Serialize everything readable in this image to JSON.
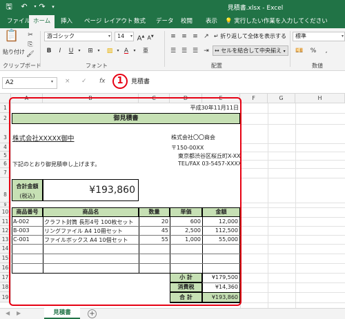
{
  "window": {
    "title": "見積書.xlsx - Excel",
    "accent": "#217346",
    "save_icon": "save-icon",
    "undo_icon": "undo-icon",
    "redo_icon": "redo-icon",
    "customize_icon": "customize-icon"
  },
  "tabs": [
    "ファイル",
    "ホーム",
    "挿入",
    "ページ レイアウト",
    "数式",
    "データ",
    "校閲",
    "表示"
  ],
  "tell_me": "実行したい作業を入力してください",
  "ribbon": {
    "paste": "貼り付け",
    "clipboard": "クリップボード",
    "font_name": "游ゴシック",
    "font_size": "14",
    "font_group": "フォント",
    "bold": "B",
    "italic": "I",
    "underline": "U",
    "font_color": "A",
    "wrap_text": "折り返して全体を表示する",
    "merge_center": "セルを結合して中央揃え",
    "alignment_group": "配置",
    "number_format": "標準",
    "number_group": "数値",
    "percent": "%"
  },
  "formula_bar": {
    "name_box": "A2",
    "cancel": "×",
    "enter": "✓",
    "fx": "fx",
    "content": "見積書",
    "callout_number": "1"
  },
  "columns": [
    "A",
    "B",
    "C",
    "D",
    "E",
    "F",
    "G",
    "H"
  ],
  "rows": [
    "1",
    "2",
    "3",
    "4",
    "5",
    "6",
    "7",
    "8",
    "9",
    "10",
    "11",
    "12",
    "13",
    "14",
    "15",
    "16",
    "17",
    "18",
    "19"
  ],
  "sheet": {
    "date": "平成30年11月11日",
    "title": "御見積書",
    "customer": "株式会社XXXXX御中",
    "company": "株式会社〇〇商会",
    "postal": "〒150-00XX",
    "address": "東京都渋谷区桜丘町X-XX",
    "tel": "TEL/FAX 03-5457-XXXX",
    "greeting": "下記のとおり御見積申し上げます。",
    "total_label": "合計金額",
    "total_tax": "(税込)",
    "total_value": "¥193,860",
    "table_headers": [
      "商品番号",
      "商品名",
      "数量",
      "単価",
      "金額"
    ],
    "items": [
      {
        "code": "A-002",
        "name": "クラフト封筒 長形4号 100枚セット",
        "qty": "20",
        "price": "600",
        "amount": "12,000"
      },
      {
        "code": "B-003",
        "name": "リングファイル A4 10冊セット",
        "qty": "45",
        "price": "2,500",
        "amount": "112,500"
      },
      {
        "code": "C-001",
        "name": "ファイルボックス A4 10個セット",
        "qty": "55",
        "price": "1,000",
        "amount": "55,000"
      }
    ],
    "subtotal_label": "小 計",
    "subtotal_value": "¥179,500",
    "tax_label": "消費税",
    "tax_value": "¥14,360",
    "grand_label": "合 計",
    "grand_value": "¥193,860"
  },
  "sheet_tab": "見積書",
  "add_sheet": "+"
}
